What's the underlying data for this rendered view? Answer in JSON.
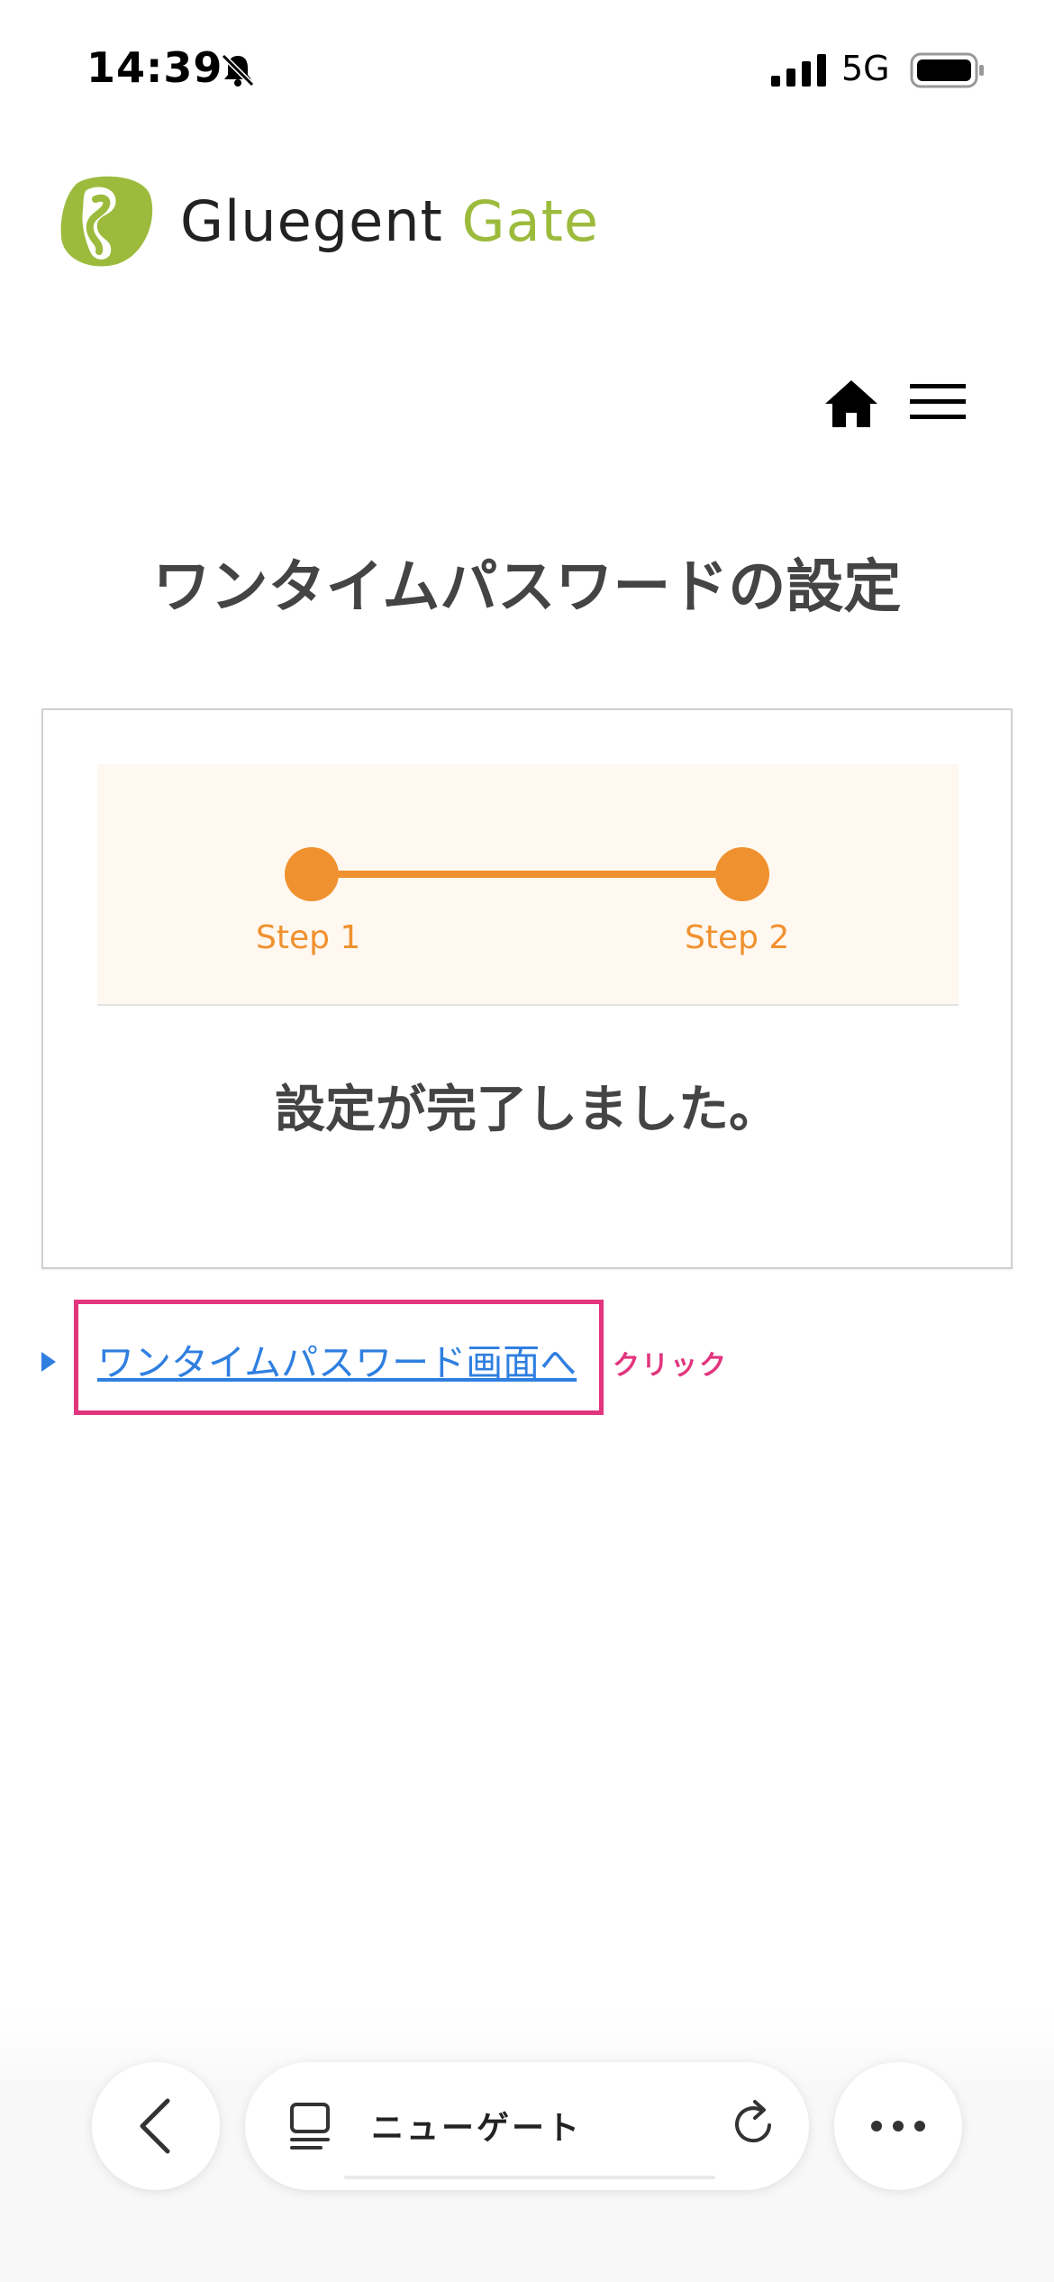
{
  "status_bar": {
    "time": "14:39",
    "network": "5G"
  },
  "logo": {
    "word1": "Gluegent",
    "word2": "Gate",
    "brand_color": "#9cbb3d"
  },
  "header": {
    "home_icon": "home-icon",
    "menu_icon": "hamburger-menu-icon"
  },
  "page": {
    "title": "ワンタイムパスワードの設定"
  },
  "card": {
    "steps": [
      {
        "label": "Step 1"
      },
      {
        "label": "Step 2"
      }
    ],
    "accent_color": "#f0912f",
    "completion_message": "設定が完了しました。"
  },
  "link": {
    "text": "ワンタイムパスワード画面へ",
    "annotation": "クリック",
    "link_color": "#2f7fe0",
    "highlight_color": "#e2357e"
  },
  "browser_toolbar": {
    "back_icon": "chevron-left-icon",
    "tabs_icon": "tabs-icon",
    "address": "ニューゲート",
    "reload_icon": "reload-icon",
    "more_icon": "more-icon"
  }
}
